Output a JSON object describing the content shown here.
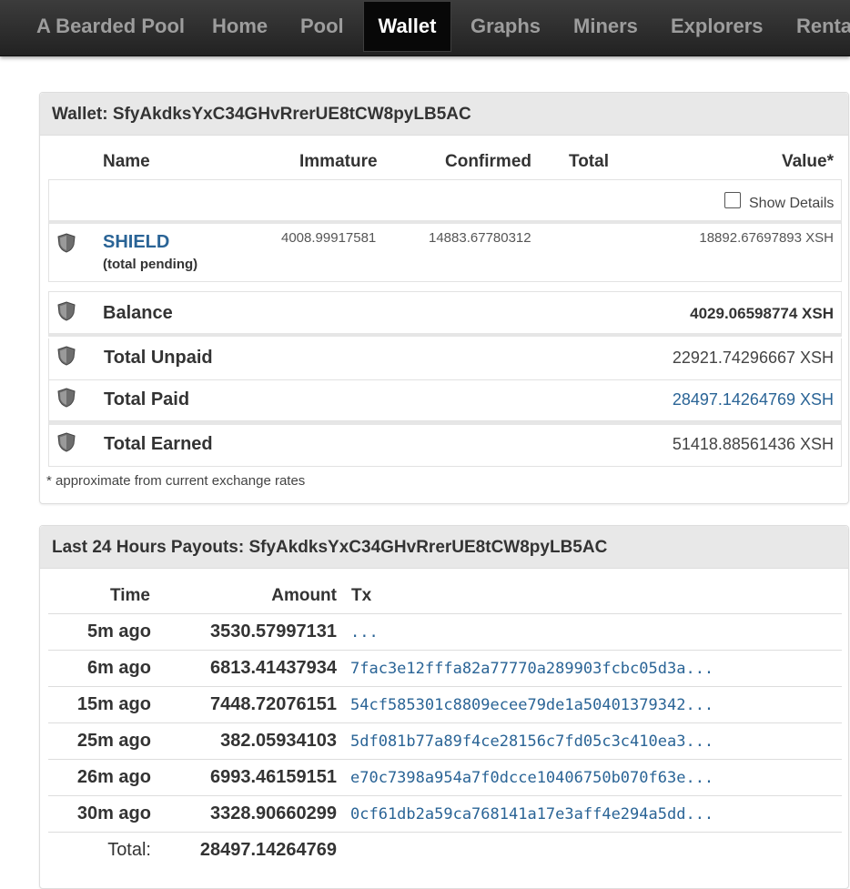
{
  "navbar": {
    "brand": "A Bearded Pool",
    "items": [
      {
        "label": "Home",
        "active": false
      },
      {
        "label": "Pool",
        "active": false
      },
      {
        "label": "Wallet",
        "active": true
      },
      {
        "label": "Graphs",
        "active": false
      },
      {
        "label": "Miners",
        "active": false
      },
      {
        "label": "Explorers",
        "active": false
      },
      {
        "label": "Renta",
        "active": false
      }
    ]
  },
  "wallet": {
    "heading": "Wallet: SfyAkdksYxC34GHvRrerUE8tCW8pyLB5AC",
    "columns": {
      "name": "Name",
      "immature": "Immature",
      "confirmed": "Confirmed",
      "total": "Total",
      "value": "Value*"
    },
    "show_details_label": "Show Details",
    "coin": {
      "name": "SHIELD",
      "sub": "(total pending)",
      "immature": "4008.99917581",
      "confirmed": "14883.67780312",
      "value": "18892.67697893 XSH"
    },
    "balance": {
      "label": "Balance",
      "value": "4029.06598774 XSH"
    },
    "total_unpaid": {
      "label": "Total Unpaid",
      "value": "22921.74296667 XSH"
    },
    "total_paid": {
      "label": "Total Paid",
      "value": "28497.14264769 XSH"
    },
    "total_earned": {
      "label": "Total Earned",
      "value": "51418.88561436 XSH"
    },
    "footnote": "* approximate from current exchange rates"
  },
  "payouts": {
    "heading": "Last 24 Hours Payouts: SfyAkdksYxC34GHvRrerUE8tCW8pyLB5AC",
    "columns": {
      "time": "Time",
      "amount": "Amount",
      "tx": "Tx"
    },
    "rows": [
      {
        "time": "5m ago",
        "amount": "3530.57997131",
        "tx": "..."
      },
      {
        "time": "6m ago",
        "amount": "6813.41437934",
        "tx": "7fac3e12fffa82a77770a289903fcbc05d3a..."
      },
      {
        "time": "15m ago",
        "amount": "7448.72076151",
        "tx": "54cf585301c8809ecee79de1a50401379342..."
      },
      {
        "time": "25m ago",
        "amount": "382.05934103",
        "tx": "5df081b77a89f4ce28156c7fd05c3c410ea3..."
      },
      {
        "time": "26m ago",
        "amount": "6993.46159151",
        "tx": "e70c7398a954a7f0dcce10406750b070f63e..."
      },
      {
        "time": "30m ago",
        "amount": "3328.90660299",
        "tx": "0cf61db2a59ca768141a17e3aff4e294a5dd..."
      }
    ],
    "total_label": "Total:",
    "total_value": "28497.14264769"
  },
  "icons": {
    "coin_icon": "shield-icon"
  }
}
